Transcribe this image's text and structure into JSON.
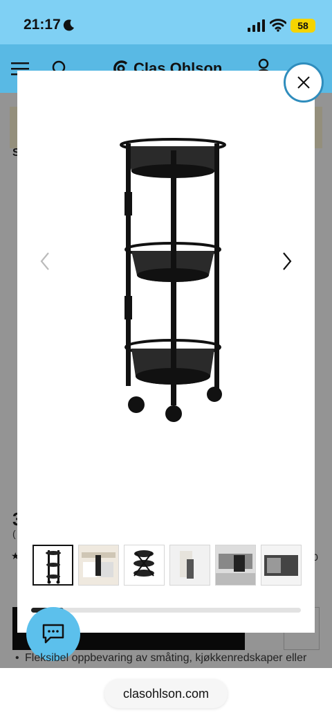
{
  "status_bar": {
    "time": "21:17",
    "battery": "58"
  },
  "header": {
    "brand": "Clas Ohlson"
  },
  "page_behind": {
    "heading_fragment": "S",
    "price_fragment": "3",
    "paren_fragment": "(",
    "rating_fragment": "★",
    "number_fragment": "0",
    "bullet": "Fleksibel oppbevaring av småting, kjøkkenredskaper eller"
  },
  "gallery": {
    "thumbnail_count": 6,
    "active_thumbnail": 1,
    "scroll_progress": 0.12
  },
  "browser": {
    "url": "clasohlson.com"
  },
  "colors": {
    "brand_blue": "#59b9e4",
    "status_blue": "#7fd0f4",
    "close_ring": "#2f8dbd",
    "chat_blue": "#5cc0ec"
  }
}
